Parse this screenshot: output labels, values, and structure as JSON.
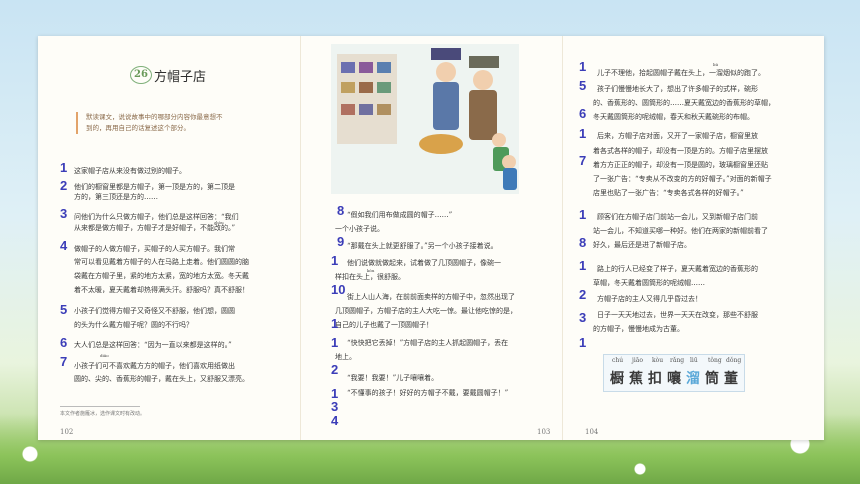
{
  "lesson": {
    "number": "26",
    "title": "方帽子店"
  },
  "hint": [
    "默读课文，说说故事中的哪部分内容你最意想不",
    "到的，再用自己的话复述这个部分。"
  ],
  "page1": [
    "这家帽子店从来没有做过别的帽子。",
    "他们的橱窗里都是方帽子，第一顶是方的，第二顶是",
    "方的，第三顶还是方的……",
    "问他们为什么只做方帽子，他们总是这样回答：“我们",
    "从来都是做方帽子，方帽子才是好帽子，不能改的。”",
    "做帽子的人做方帽子，买帽子的人买方帽子。我们常",
    "常可以看见戴着方帽子的人在马路上走着。他们圆圆的脑",
    "袋戴在方帽子里，紧的地方太紧，宽的地方太宽。冬天戴",
    "着不太暖，夏天戴着却热得满头汗。舒服吗？真不舒服！",
    "小孩子们觉得方帽子又奇怪又不舒服，他们想，圆圆",
    "的头为什么戴方帽子呢？圆的不行吗？",
    "大人们总是这样回答：“因为一直以来都是这样的。”",
    "小孩子们可不喜欢戴方方的帽子，他们喜欢用纸做出",
    "圆的、尖的、香蕉形的帽子，戴在头上，又舒服又漂亮。"
  ],
  "page1_ruby": {
    "diao": "diāo",
    "zhou": "zhòu"
  },
  "footnote": "本文作者施雁冰，选作课文时有改动。",
  "page2": [
    "“假如我们用布做成圆的帽子……”",
    "一个小孩子说。",
    "“那戴在头上就更舒服了。”另一个小孩子接着说。",
    "他们说做就做起来，试着做了几顶圆帽子，像碗一",
    "样扣在头上，很舒服。",
    "街上人山人海，在前前面卖样的方帽子中，忽然出现了",
    "几顶圆帽子，方帽子店的主人大吃一惊。最让他吃惊的是，",
    "自己的儿子也戴了一顶圆帽子！",
    "“快快把它丢掉！”方帽子店的主人抓起圆帽子，丢在",
    "地上。",
    "“我要！我要！”儿子嚷嚷着。",
    "“不懂事的孩子！好好的方帽子不戴，要戴圆帽子！”"
  ],
  "page2_ruby": {
    "kou": "kòu"
  },
  "page3": [
    "儿子不理他，拾起圆帽子戴在头上，一溜烟似的跑了。",
    "孩子们慢慢地长大了，想出了许多帽子的式样，碗形",
    "的、香蕉形的、圆筒形的……夏天戴宽边的香蕉形的草帽，",
    "冬天戴圆筒形的呢绒帽，春天和秋天戴碗形的布帽。",
    "后来，方帽子店对面，又开了一家帽子店，橱窗里放",
    "着各式各样的帽子，却没有一顶是方的。方帽子店里摆放",
    "着方方正正的帽子，却没有一顶是圆的，玻璃橱窗里还贴",
    "了一张广告：“专卖从不改变的方的好帽子。”对面的新帽子",
    "店里也贴了一张广告：“专卖各式各样的好帽子。”",
    "顾客们在方帽子店门前站一会儿，又到新帽子店门前",
    "站一会儿，不知道买哪一种好。他们在两家的新帽前看了",
    "好久，最后还是进了新帽子店。",
    "路上的行人已经变了样子，夏天戴着宽边的香蕉形的",
    "草帽，冬天戴着圆筒形的呢绒帽……",
    "方帽子店的主人又得几乎昏过去！",
    "日子一天天地过去，世界一天天在改变，那些不舒服",
    "的方帽子，慢慢地成为古董。"
  ],
  "page3_ruby": {
    "liu": "liū"
  },
  "word_card": {
    "pinyin": [
      "chú",
      "jiāo",
      "kòu",
      "rǎng",
      "liū",
      "tǒng",
      "dǒng"
    ],
    "hanzi": [
      "橱",
      "蕉",
      "扣",
      "嚷",
      "溜",
      "筒",
      "董"
    ]
  },
  "page_numbers": {
    "left": "102",
    "middle": "103",
    "right": "104"
  },
  "handwritten": {
    "n1": "1",
    "n2": "2",
    "n3": "3",
    "n4": "4",
    "n5": "5",
    "n6": "6",
    "n7": "7",
    "n8": "8",
    "n9": "9",
    "n0": "0",
    "n10": "10",
    "n2b": "2",
    "n3b": "3"
  },
  "colors": {
    "ink": "#3b3db8",
    "accent_blue": "#5aa8d8",
    "hint_border": "#e2a36a"
  }
}
